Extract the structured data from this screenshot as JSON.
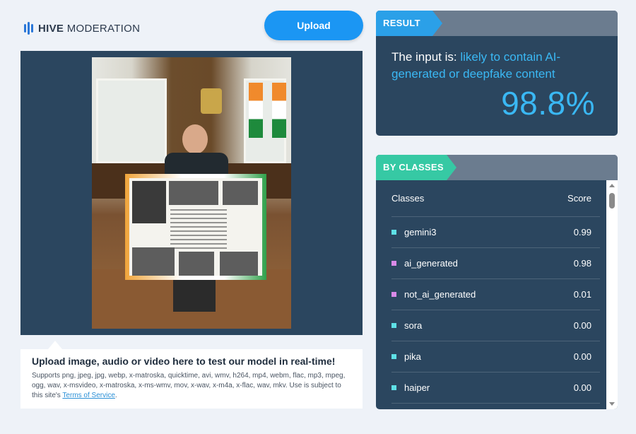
{
  "header": {
    "logo_bold": "HIVE",
    "logo_light": "MODERATION",
    "upload_label": "Upload"
  },
  "info": {
    "title": "Upload image, audio or video here to test our model in real-time!",
    "supports": "Supports png, jpeg, jpg, webp, x-matroska, quicktime, avi, wmv, h264, mp4, webm, flac, mp3, mpeg, ogg, wav, x-msvideo, x-matroska, x-ms-wmv, mov, x-wav, x-m4a, x-flac, wav, mkv. Use is subject to this site's ",
    "terms_link": "Terms of Service",
    "terms_suffix": "."
  },
  "result": {
    "tag": "RESULT",
    "prefix": "The input is: ",
    "verdict": "likely to contain AI-generated or deepfake content",
    "percentage": "98.8%"
  },
  "classes": {
    "tag": "BY CLASSES",
    "col_classes": "Classes",
    "col_score": "Score",
    "rows": [
      {
        "name": "gemini3",
        "score": "0.99",
        "color": "#5ee0e6"
      },
      {
        "name": "ai_generated",
        "score": "0.98",
        "color": "#d98ae8"
      },
      {
        "name": "not_ai_generated",
        "score": "0.01",
        "color": "#d98ae8"
      },
      {
        "name": "sora",
        "score": "0.00",
        "color": "#5ee0e6"
      },
      {
        "name": "pika",
        "score": "0.00",
        "color": "#5ee0e6"
      },
      {
        "name": "haiper",
        "score": "0.00",
        "color": "#5ee0e6"
      }
    ]
  },
  "colors": {
    "accent_blue": "#1b96f3",
    "panel_bg": "#2b465f",
    "result_tag": "#2ba0e8",
    "classes_tag": "#36c9a4"
  }
}
